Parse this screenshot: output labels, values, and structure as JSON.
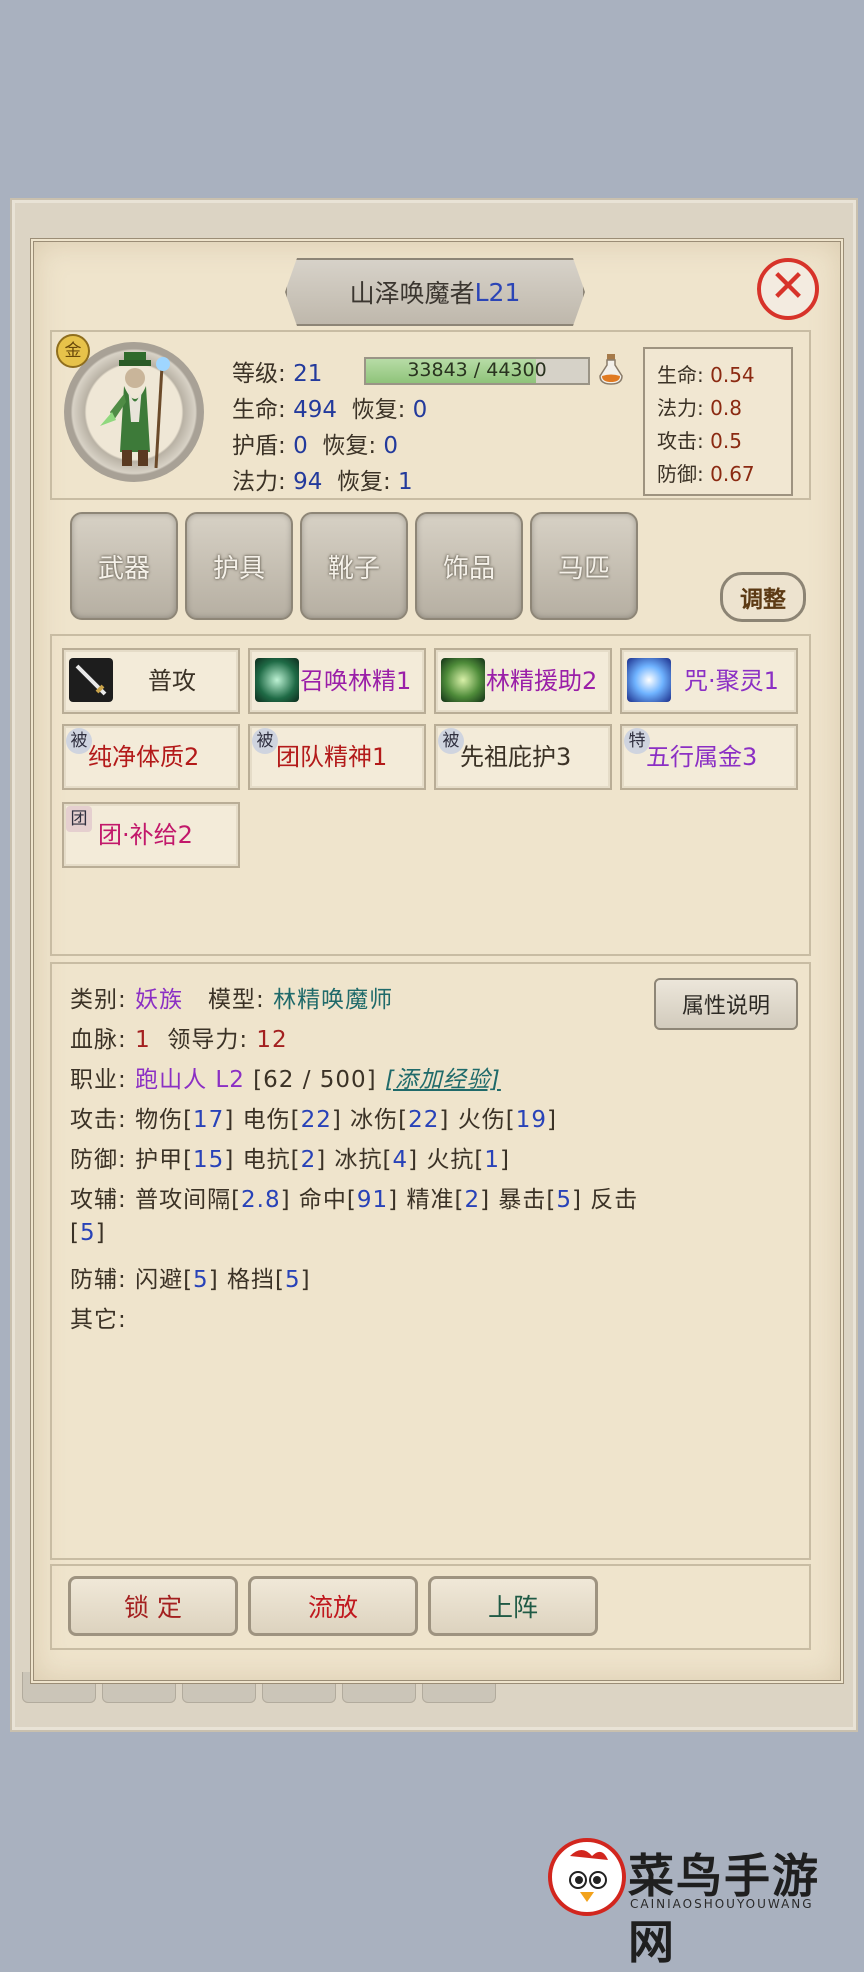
{
  "header": {
    "title_name": "山泽唤魔者",
    "title_level": "L21"
  },
  "close_symbol": "✕",
  "portrait": {
    "badge": "金"
  },
  "stats": {
    "level_label": "等级:",
    "level": "21",
    "exp_text": "33843 / 44300",
    "exp_fraction": 0.764,
    "hp_label": "生命:",
    "hp": "494",
    "hp_regen_label": "恢复:",
    "hp_regen": "0",
    "shield_label": "护盾:",
    "shield": "0",
    "shield_regen_label": "恢复:",
    "shield_regen": "0",
    "mp_label": "法力:",
    "mp": "94",
    "mp_regen_label": "恢复:",
    "mp_regen": "1"
  },
  "growth": [
    {
      "label": "生命:",
      "value": "0.54"
    },
    {
      "label": "法力:",
      "value": "0.8"
    },
    {
      "label": "攻击:",
      "value": "0.5"
    },
    {
      "label": "防御:",
      "value": "0.67"
    }
  ],
  "equipment": [
    "武器",
    "护具",
    "靴子",
    "饰品",
    "马匹"
  ],
  "adjust_label": "调整",
  "skills": [
    {
      "tag": "",
      "name": "普攻",
      "color": "#3b3226",
      "icon": "sword-icon"
    },
    {
      "tag": "",
      "name": "召唤林精1",
      "color": "#9a1fa8",
      "icon": "summon-icon"
    },
    {
      "tag": "",
      "name": "林精援助2",
      "color": "#9a1fa8",
      "icon": "leaf-icon"
    },
    {
      "tag": "",
      "name": "咒·聚灵1",
      "color": "#8b2fc4",
      "icon": "spirit-icon"
    },
    {
      "tag": "被",
      "name": "纯净体质2",
      "color": "#b31a1a"
    },
    {
      "tag": "被",
      "name": "团队精神1",
      "color": "#b31a1a"
    },
    {
      "tag": "被",
      "name": "先祖庇护3",
      "color": "#3b3226"
    },
    {
      "tag": "特",
      "name": "五行属金3",
      "color": "#8b2fc4"
    },
    {
      "tag": "团",
      "name": "团·补给2",
      "color": "#c2186b"
    }
  ],
  "attr_btn": "属性说明",
  "info": {
    "type_label": "类别:",
    "type": "妖族",
    "model_label": "模型:",
    "model": "林精唤魔师",
    "blood_label": "血脉:",
    "blood": "1",
    "lead_label": "领导力:",
    "lead": "12",
    "job_label": "职业:",
    "job": "跑山人 L2",
    "job_exp": "[62 / 500]",
    "add_exp": "[添加经验]",
    "atk_label": "攻击:",
    "atk_line": [
      "物伤[",
      "17",
      "] 电伤[",
      "22",
      "] 冰伤[",
      "22",
      "] 火伤[",
      "19",
      "]"
    ],
    "def_label": "防御:",
    "def_line": [
      "护甲[",
      "15",
      "] 电抗[",
      "2",
      "] 冰抗[",
      "4",
      "] 火抗[",
      "1",
      "]"
    ],
    "aux_label": "攻辅:",
    "aux_line": [
      "普攻间隔[",
      "2.8",
      "] 命中[",
      "91",
      "] 精准[",
      "2",
      "] 暴击[",
      "5",
      "] 反击"
    ],
    "aux_line2": [
      "[",
      "5",
      "]"
    ],
    "daux_label": "防辅:",
    "daux_line": [
      "闪避[",
      "5",
      "] 格挡[",
      "5",
      "]"
    ],
    "other_label": "其它:"
  },
  "buttons": {
    "lock": "锁 定",
    "exile": "流放",
    "deploy": "上阵"
  },
  "watermark": {
    "title": "菜鸟手游网",
    "sub": "CAINIAOSHOUYOUWANG"
  }
}
